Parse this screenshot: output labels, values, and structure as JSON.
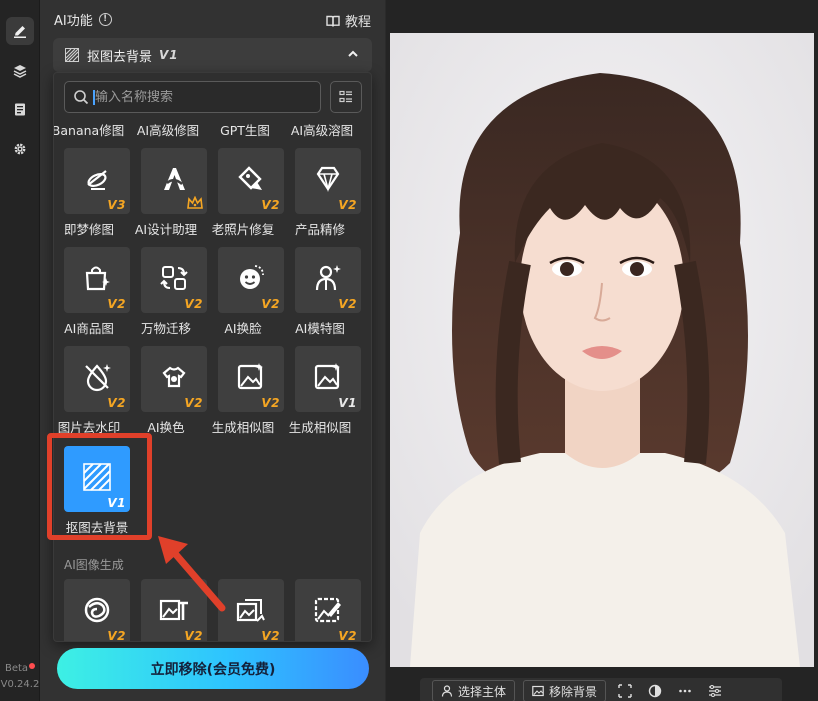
{
  "rail": {
    "beta_label": "Beta",
    "version": "V0.24.2",
    "icons": [
      "edit-icon",
      "layers-icon",
      "clipboard-icon",
      "gear-icon"
    ]
  },
  "panel": {
    "title": "AI功能",
    "tutorial_label": "教程",
    "current_tool": {
      "name": "抠图去背景",
      "version": "V1"
    }
  },
  "search": {
    "placeholder": "输入名称搜索",
    "value": ""
  },
  "top_row_labels": [
    "Banana修图",
    "AI高级修图",
    "GPT生图",
    "AI高级溶图"
  ],
  "tools": [
    {
      "label": "即梦修图",
      "version": "V3",
      "version_color": "orange",
      "icon": "jimeng-icon"
    },
    {
      "label": "AI设计助理",
      "version": "",
      "crown": true,
      "icon": "ai-design-icon"
    },
    {
      "label": "老照片修复",
      "version": "V2",
      "version_color": "orange",
      "icon": "photo-repair-icon"
    },
    {
      "label": "产品精修",
      "version": "V2",
      "version_color": "orange",
      "icon": "diamond-icon"
    },
    {
      "label": "AI商品图",
      "version": "V2",
      "version_color": "orange",
      "icon": "shopping-bag-icon"
    },
    {
      "label": "万物迁移",
      "version": "V2",
      "version_color": "orange",
      "icon": "transfer-icon"
    },
    {
      "label": "AI换脸",
      "version": "V2",
      "version_color": "orange",
      "icon": "face-swap-icon"
    },
    {
      "label": "AI模特图",
      "version": "V2",
      "version_color": "orange",
      "icon": "model-icon"
    },
    {
      "label": "图片去水印",
      "version": "V2",
      "version_color": "orange",
      "icon": "watermark-remove-icon"
    },
    {
      "label": "AI换色",
      "version": "V2",
      "version_color": "orange",
      "icon": "palette-icon"
    },
    {
      "label": "生成相似图",
      "version": "V2",
      "version_color": "orange",
      "icon": "similar-image-icon"
    },
    {
      "label": "生成相似图",
      "version": "V1",
      "version_color": "white",
      "icon": "similar-image-icon"
    },
    {
      "label": "抠图去背景",
      "version": "V1",
      "version_color": "white",
      "icon": "cutout-icon",
      "selected": true
    }
  ],
  "section": {
    "title": "AI图像生成"
  },
  "gen_tools": [
    {
      "version": "V2",
      "icon": "swirl-icon"
    },
    {
      "version": "V2",
      "icon": "image-text-icon"
    },
    {
      "version": "V2",
      "icon": "image-convert-icon"
    },
    {
      "version": "V2",
      "icon": "image-edit-icon"
    }
  ],
  "cta": {
    "label": "立即移除(会员免费)"
  },
  "bottom_bar": {
    "select_subject": "选择主体",
    "remove_background": "移除背景"
  },
  "colors": {
    "accent": "#2f9bff",
    "highlight": "#e0402a",
    "version_tag": "#f5a623"
  }
}
